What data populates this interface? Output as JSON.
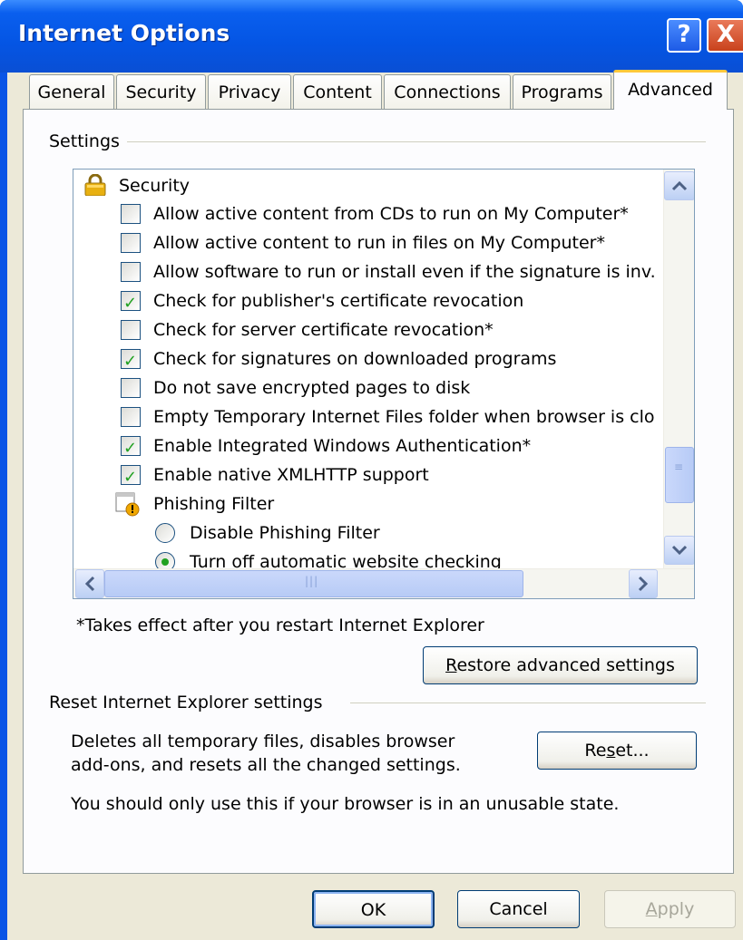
{
  "window": {
    "title": "Internet Options",
    "help_label": "?",
    "close_label": "X"
  },
  "tabs": [
    {
      "label": "General"
    },
    {
      "label": "Security"
    },
    {
      "label": "Privacy"
    },
    {
      "label": "Content"
    },
    {
      "label": "Connections"
    },
    {
      "label": "Programs"
    },
    {
      "label": "Advanced",
      "active": true
    }
  ],
  "settings": {
    "group_label": "Settings",
    "category_security": "Security",
    "items": [
      {
        "label": "Allow active content from CDs to run on My Computer*",
        "checked": false
      },
      {
        "label": "Allow active content to run in files on My Computer*",
        "checked": false
      },
      {
        "label": "Allow software to run or install even if the signature is inv.",
        "checked": false
      },
      {
        "label": "Check for publisher's certificate revocation",
        "checked": true
      },
      {
        "label": "Check for server certificate revocation*",
        "checked": false
      },
      {
        "label": "Check for signatures on downloaded programs",
        "checked": true
      },
      {
        "label": "Do not save encrypted pages to disk",
        "checked": false
      },
      {
        "label": "Empty Temporary Internet Files folder when browser is clo",
        "checked": false
      },
      {
        "label": "Enable Integrated Windows Authentication*",
        "checked": true
      },
      {
        "label": "Enable native XMLHTTP support",
        "checked": true
      }
    ],
    "category_phishing": "Phishing Filter",
    "radios": [
      {
        "label": "Disable Phishing Filter",
        "selected": false
      },
      {
        "label": "Turn off automatic website checking",
        "selected": true
      }
    ],
    "restart_note": "*Takes effect after you restart Internet Explorer",
    "restore_button_rest": "estore advanced settings",
    "restore_button_access": "R"
  },
  "reset": {
    "group_label": "Reset Internet Explorer settings",
    "description_line1": "Deletes all temporary files, disables browser",
    "description_line2": "add-ons, and resets all the changed settings.",
    "warning": "You should only use this if your browser is in an unusable state.",
    "button_pre": "Re",
    "button_access": "s",
    "button_post": "et..."
  },
  "footer": {
    "ok_label": "OK",
    "cancel_label": "Cancel",
    "apply_access": "A",
    "apply_rest": "pply"
  },
  "colors": {
    "titlebar": "#0455e4",
    "dialog_bg": "#ece9d8",
    "check_green": "#21a121",
    "active_tab_accent": "#ffc83c"
  }
}
